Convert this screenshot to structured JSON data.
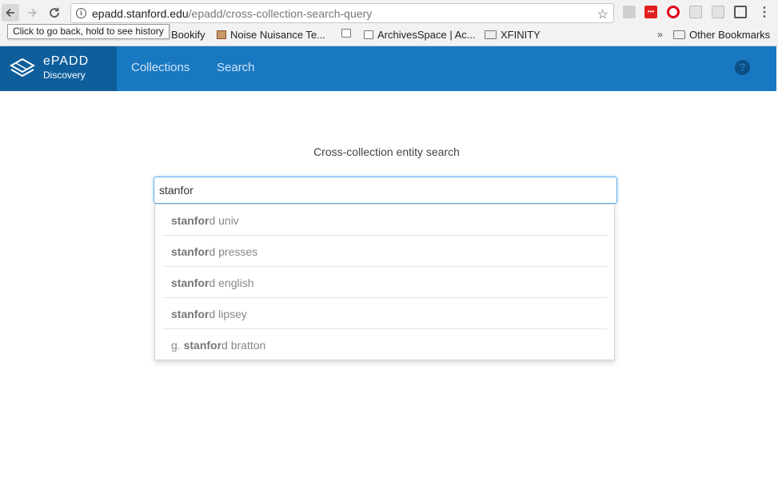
{
  "browser": {
    "url_host": "epadd.stanford.edu",
    "url_path": "/epadd/cross-collection-search-query",
    "tooltip": "Click to go back, hold to see history",
    "bookmarks": [
      {
        "label": "Bookify"
      },
      {
        "label": "Noise Nuisance Te..."
      },
      {
        "label": "ArchivesSpace | Ac..."
      },
      {
        "label": "XFINITY"
      }
    ],
    "other_bookmarks": "Other Bookmarks",
    "more_chevron": "»",
    "star_icon": "star-icon",
    "menu_dots": "⋮",
    "opera_ext_label": "•••"
  },
  "app": {
    "brand_name": "ePADD",
    "brand_sub": "Discovery",
    "nav": [
      {
        "label": "Collections"
      },
      {
        "label": "Search"
      }
    ],
    "help_symbol": "?",
    "accent_color": "#1978c2"
  },
  "search": {
    "title": "Cross-collection entity search",
    "query": "stanfor",
    "suggestions": [
      {
        "prefix": "",
        "match": "stanfor",
        "rest": "d univ"
      },
      {
        "prefix": "",
        "match": "stanfor",
        "rest": "d presses"
      },
      {
        "prefix": "",
        "match": "stanfor",
        "rest": "d english"
      },
      {
        "prefix": "",
        "match": "stanfor",
        "rest": "d lipsey"
      },
      {
        "prefix": "g. ",
        "match": "stanfor",
        "rest": "d bratton"
      }
    ]
  }
}
